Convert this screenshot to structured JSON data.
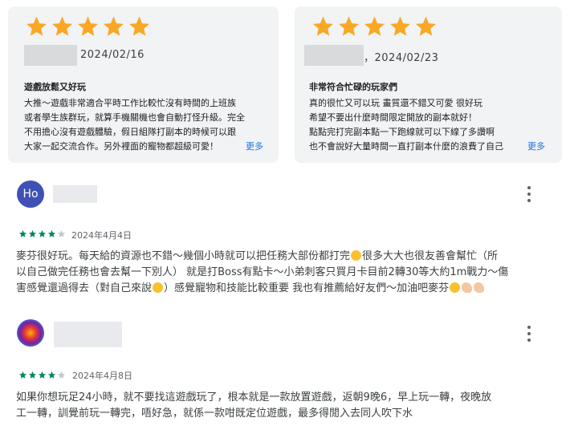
{
  "colors": {
    "star_gold": "#f9a825",
    "star_green": "#01875f",
    "link_blue": "#1a73e8",
    "avatar_ho": "#3f51b5",
    "card_bg": "#f1f3f4"
  },
  "cards": [
    {
      "rating": 5,
      "date": "2024/02/16",
      "title": "遊戲放鬆又好玩",
      "body_lines": [
        "大推～遊戲非常適合平時工作比較忙沒有時間的上班族",
        "或者學生族群玩，就算手機關機也會自動打怪升級。完全",
        "不用擔心沒有遊戲體驗，假日組隊打副本的時候可以跟",
        "大家一起交流合作。另外裡面的寵物都超級可愛！"
      ],
      "more": "更多"
    },
    {
      "rating": 5,
      "date": "，2024/02/23",
      "title": "非常符合忙碌的玩家們",
      "body_lines": [
        "真的很忙又可以玩 畫質還不錯又可愛 很好玩",
        "希望不要出什麼時間限定開放的副本就好！",
        "點點完打完副本點一下跑線就可以下線了多讚啊",
        "也不會說好大量時間一直打副本什麼的浪費了自己"
      ],
      "more": "更多"
    }
  ],
  "reviews": [
    {
      "avatar_initials": "Ho",
      "rating": 4,
      "date": "2024年4月4日",
      "text_lines": [
        "麥芬很好玩。每天給的資源也不錯～幾個小時就可以把任務大部份都打完",
        "以自己做完任務也會去幫一下別人） 就是打Boss有點卡～小弟刺客只買月卡目前2轉30等大約1m戰力～傷",
        "害感覺還過得去（對自己來說",
        "）感覺寵物和技能比較重要 我也有推薦給好友們～加油吧麥芬"
      ],
      "line1_tail": "很多大大也很友善會幫忙（所"
    },
    {
      "avatar_initials": "",
      "avatar_icon": "lion-avatar-icon",
      "rating": 4,
      "date": "2024年4月8日",
      "text_lines": [
        "如果你想玩足24小時，就不要找這遊戲玩了，根本就是一款放置遊戲，返朝9晚6，早上玩一轉，夜晚放",
        "工一轉，訓覺前玩一轉完，唔好急，就係一款咁既定位遊戲，最多得閒入去同人吹下水"
      ]
    }
  ]
}
